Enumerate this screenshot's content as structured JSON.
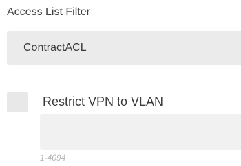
{
  "access_list_filter": {
    "label": "Access List Filter",
    "value": "ContractACL"
  },
  "restrict_vpn": {
    "label": "Restrict VPN to VLAN",
    "checked": false,
    "input_value": "",
    "hint": "1-4094"
  },
  "colors": {
    "field_background": "#ebebeb",
    "input_background": "#f1f1f1",
    "hint_text": "#b5b5b5",
    "label_text": "#3d3d3d"
  }
}
